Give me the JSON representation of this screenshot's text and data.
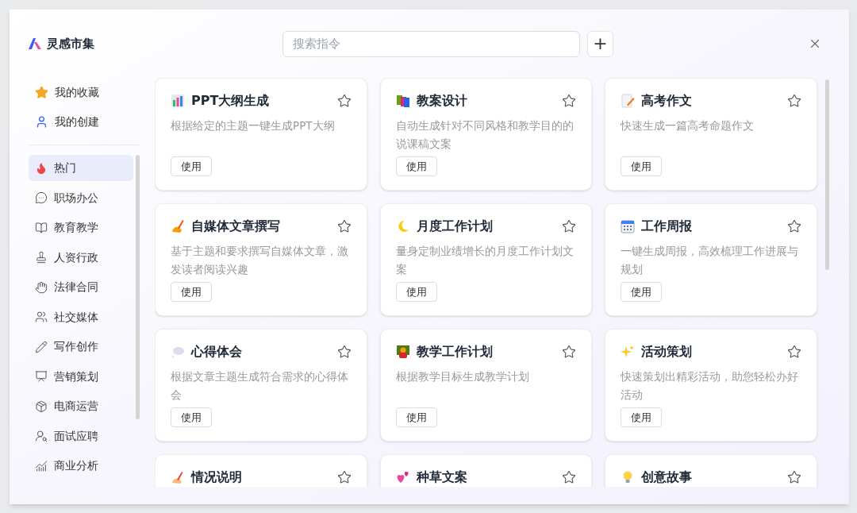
{
  "app": {
    "name": "灵感市集"
  },
  "search": {
    "placeholder": "搜索指令"
  },
  "add_button": {
    "label": "+"
  },
  "sidebar": {
    "top_items": [
      {
        "label": "我的收藏",
        "selected": false
      },
      {
        "label": "我的创建",
        "selected": false
      }
    ],
    "categories": [
      {
        "label": "热门",
        "selected": true
      },
      {
        "label": "职场办公",
        "selected": false
      },
      {
        "label": "教育教学",
        "selected": false
      },
      {
        "label": "人资行政",
        "selected": false
      },
      {
        "label": "法律合同",
        "selected": false
      },
      {
        "label": "社交媒体",
        "selected": false
      },
      {
        "label": "写作创作",
        "selected": false
      },
      {
        "label": "营销策划",
        "selected": false
      },
      {
        "label": "电商运营",
        "selected": false
      },
      {
        "label": "面试应聘",
        "selected": false
      },
      {
        "label": "商业分析",
        "selected": false
      }
    ]
  },
  "cards": [
    {
      "title": "PPT大纲生成",
      "description": "根据给定的主题一键生成PPT大纲",
      "button": "使用"
    },
    {
      "title": "教案设计",
      "description": "自动生成针对不同风格和教学目的的说课稿文案",
      "button": "使用"
    },
    {
      "title": "高考作文",
      "description": "快速生成一篇高考命题作文",
      "button": "使用"
    },
    {
      "title": "自媒体文章撰写",
      "description": "基于主题和要求撰写自媒体文章，激发读者阅读兴趣",
      "button": "使用"
    },
    {
      "title": "月度工作计划",
      "description": "量身定制业绩增长的月度工作计划文案",
      "button": "使用"
    },
    {
      "title": "工作周报",
      "description": "一键生成周报，高效梳理工作进展与规划",
      "button": "使用"
    },
    {
      "title": "心得体会",
      "description": "根据文章主题生成符合需求的心得体会",
      "button": "使用"
    },
    {
      "title": "教学工作计划",
      "description": "根据教学目标生成教学计划",
      "button": "使用"
    },
    {
      "title": "活动策划",
      "description": "快速策划出精彩活动，助您轻松办好活动",
      "button": "使用"
    },
    {
      "title": "情况说明"
    },
    {
      "title": "种草文案"
    },
    {
      "title": "创意故事"
    }
  ]
}
